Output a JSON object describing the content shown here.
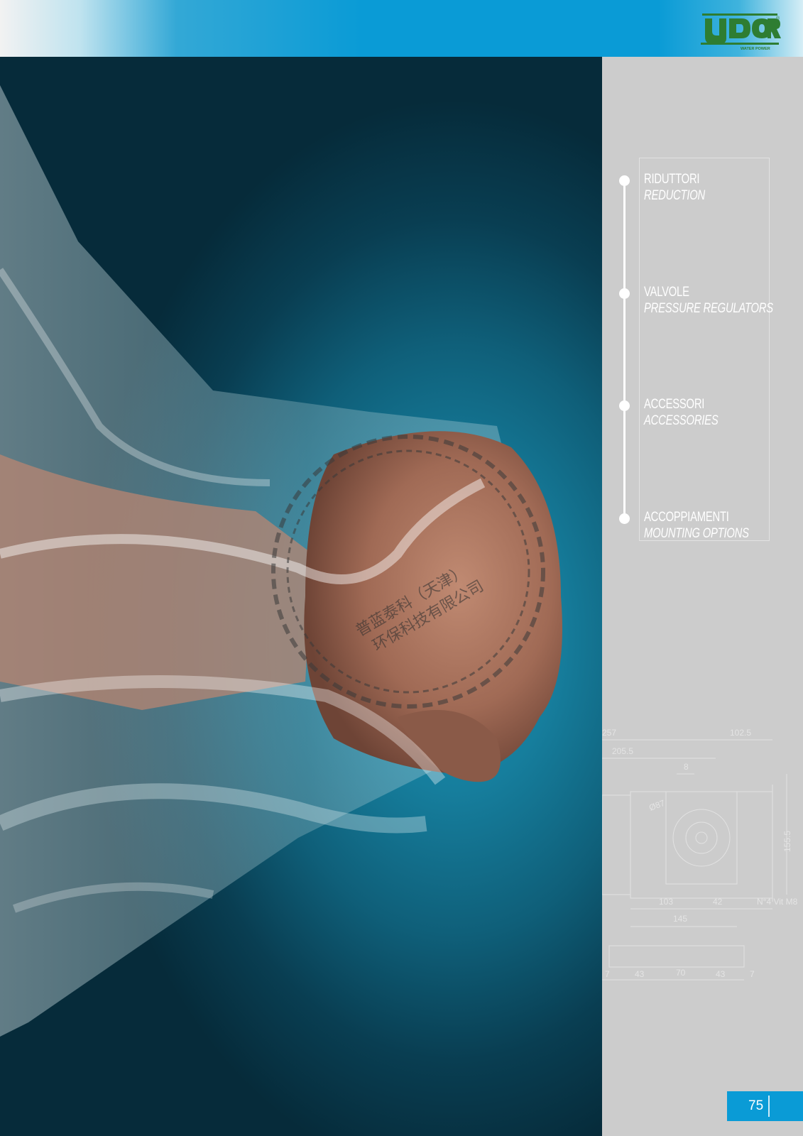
{
  "brand": {
    "logo_text": "UDOR",
    "logo_tagline": "WATER POWER",
    "logo_mark": "®"
  },
  "colors": {
    "accent_blue": "#0a9bd6",
    "sidebar_grey": "#cccccc",
    "logo_green": "#2e7d32"
  },
  "menu": {
    "items": [
      {
        "label_it": "RIDUTTORI",
        "label_en": "REDUCTION"
      },
      {
        "label_it": "VALVOLE",
        "label_en": "PRESSURE REGULATORS"
      },
      {
        "label_it": "ACCESSORI",
        "label_en": "ACCESSORIES"
      },
      {
        "label_it": "ACCOPPIAMENTI",
        "label_en": "MOUNTING OPTIONS"
      }
    ]
  },
  "drawing": {
    "dims": [
      "257",
      "102.5",
      "205.5",
      "8",
      "Ø87",
      "155.5",
      "103",
      "42",
      "145",
      "N°4 Vit M8",
      "7",
      "43",
      "70",
      "43",
      "7"
    ]
  },
  "stamp": {
    "line1": "普蓝泰科（天津）",
    "line2": "环保科技有限公司"
  },
  "page": {
    "number": "75"
  }
}
